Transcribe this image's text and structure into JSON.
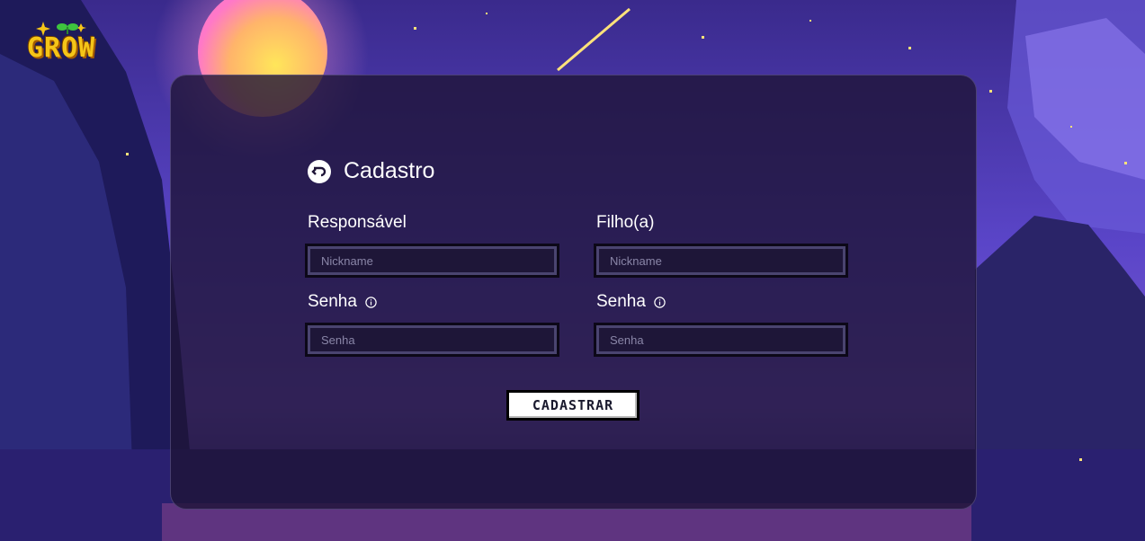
{
  "logo": {
    "text": "GROW"
  },
  "form": {
    "title": "Cadastro",
    "parent_label": "Responsável",
    "child_label": "Filho(a)",
    "parent_nickname_placeholder": "Nickname",
    "child_nickname_placeholder": "Nickname",
    "parent_password_label": "Senha",
    "child_password_label": "Senha",
    "parent_password_placeholder": "Senha",
    "child_password_placeholder": "Senha",
    "submit_label": "CADASTRAR"
  },
  "colors": {
    "panel": "#1e1437",
    "logo": "#f5c518",
    "accent": "#ffffff"
  }
}
